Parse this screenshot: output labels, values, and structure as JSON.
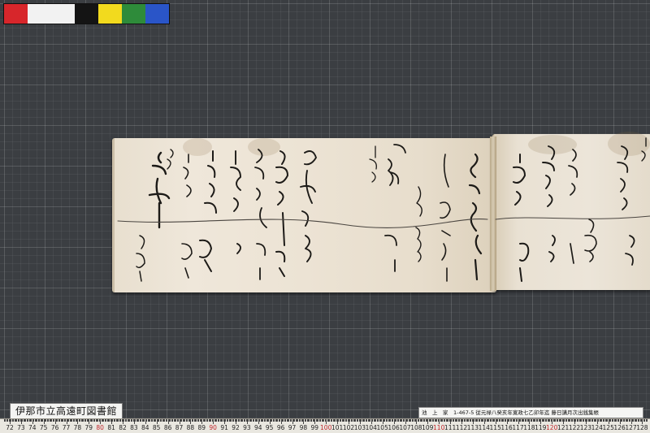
{
  "color_chart": {
    "swatches": [
      "#d7262b",
      "#f2f2f2",
      "#141414",
      "#f2da1e",
      "#2e8b3a",
      "#2a55c8"
    ]
  },
  "library_label": "伊那市立高遠町図書館",
  "catalog_label": "池　上　家　1-467-5 従元禄八癸亥年寛政七乙卯年迄 藤日講月次出銭集帳",
  "ruler": {
    "numbers": [
      "72",
      "73",
      "74",
      "75",
      "76",
      "77",
      "78",
      "79",
      "80",
      "81",
      "82",
      "83",
      "84",
      "85",
      "86",
      "87",
      "88",
      "89",
      "90",
      "91",
      "92",
      "93",
      "94",
      "95",
      "96",
      "97",
      "98",
      "99",
      "100",
      "101",
      "102",
      "103",
      "104",
      "105",
      "106",
      "107",
      "108",
      "109",
      "110",
      "111",
      "112",
      "113",
      "114",
      "115",
      "116",
      "117",
      "118",
      "119",
      "120",
      "121",
      "122",
      "123",
      "124",
      "125",
      "126",
      "127",
      "128"
    ],
    "highlight": [
      "80",
      "90",
      "100",
      "110",
      "120"
    ]
  }
}
